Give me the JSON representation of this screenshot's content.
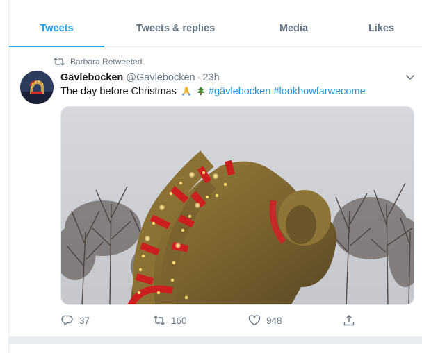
{
  "tabs": [
    {
      "label": "Tweets",
      "active": true
    },
    {
      "label": "Tweets & replies",
      "active": false
    },
    {
      "label": "Media",
      "active": false
    },
    {
      "label": "Likes",
      "active": false
    }
  ],
  "tweet": {
    "retweeted_by": "Barbara Retweeted",
    "name": "Gävlebocken",
    "handle": "@Gavlebocken",
    "separator": "·",
    "time": "23h",
    "text": "The day before Christmas",
    "emojis": [
      "folded-hands-emoji",
      "christmas-tree-emoji"
    ],
    "hashtags": [
      "#gävlebocken",
      "#lookhowfarwecome"
    ],
    "stats": {
      "replies": "37",
      "retweets": "160",
      "likes": "948"
    }
  },
  "colors": {
    "accent": "#1da1f2",
    "link": "#1b95e0",
    "muted": "#657786",
    "divider": "#e6ecf0"
  }
}
